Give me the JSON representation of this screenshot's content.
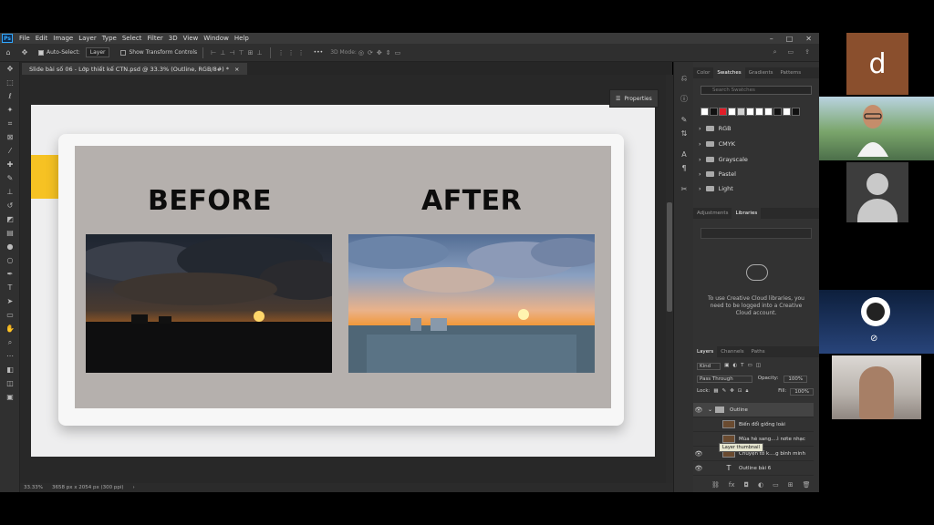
{
  "menubar": {
    "logo": "Ps",
    "items": [
      "File",
      "Edit",
      "Image",
      "Layer",
      "Type",
      "Select",
      "Filter",
      "3D",
      "View",
      "Window",
      "Help"
    ]
  },
  "optionsbar": {
    "auto_select_label": "Auto-Select:",
    "layer_select_value": "Layer",
    "show_transform_label": "Show Transform Controls",
    "more": "•••",
    "mode_3d": "3D Mode:"
  },
  "document_tab": {
    "title": "Slide bài số 06 - Lớp thiết kế CTN.psd @ 33.3% (Outline, RGB/8#) *",
    "close": "×"
  },
  "canvas": {
    "before_heading": "BEFORE",
    "after_heading": "AFTER"
  },
  "properties_label": "Properties",
  "statusbar": {
    "zoom": "33.33%",
    "doc_size": "3658 px x 2054 px (300 ppi)"
  },
  "swatches_panel": {
    "tabs": [
      "Color",
      "Swatches",
      "Gradients",
      "Patterns"
    ],
    "active_tab": "Swatches",
    "search_placeholder": "Search Swatches",
    "swatch_colors": [
      "#ffffff",
      "#111111",
      "#e11d28",
      "#ffffff",
      "#cfcfcf",
      "#ffffff",
      "#ffffff",
      "#ffffff",
      "#111111",
      "#ffffff",
      "#111111"
    ],
    "groups": [
      "RGB",
      "CMYK",
      "Grayscale",
      "Pastel",
      "Light"
    ]
  },
  "libraries_panel": {
    "tabs": [
      "Adjustments",
      "Libraries"
    ],
    "active_tab": "Libraries",
    "message": "To use Creative Cloud libraries, you need to be logged into a Creative Cloud account."
  },
  "layers_panel": {
    "tabs": [
      "Layers",
      "Channels",
      "Paths"
    ],
    "active_tab": "Layers",
    "kind_label": "Kind",
    "blend_mode": "Pass Through",
    "opacity_label": "Opacity:",
    "opacity_value": "100%",
    "lock_label": "Lock:",
    "fill_label": "Fill:",
    "fill_value": "100%",
    "rows": [
      {
        "name": "Outline",
        "type": "group"
      },
      {
        "name": "Biến đổi giống loài",
        "type": "image"
      },
      {
        "name": "Mùa hè sang....ì nơte nhạc",
        "type": "image"
      },
      {
        "name": "Chuyện tổ k....g bình minh",
        "type": "image"
      },
      {
        "name": "Outline bài 6",
        "type": "text"
      }
    ],
    "tooltip": "Layer thumbnail"
  },
  "zoom_participants": {
    "initial": "d"
  }
}
